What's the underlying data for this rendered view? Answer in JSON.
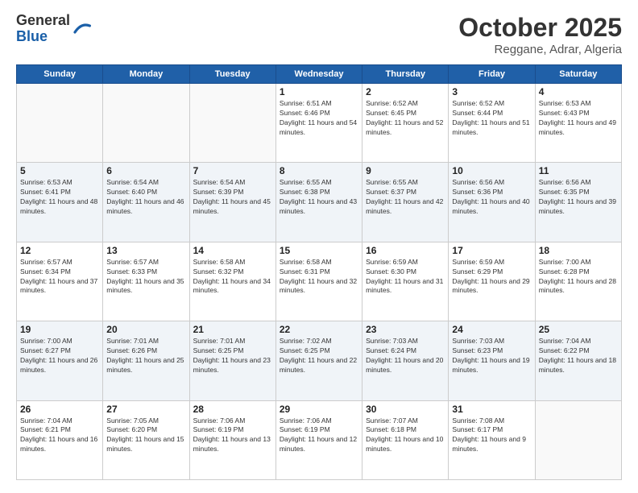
{
  "header": {
    "logo_line1": "General",
    "logo_line2": "Blue",
    "month": "October 2025",
    "location": "Reggane, Adrar, Algeria"
  },
  "weekdays": [
    "Sunday",
    "Monday",
    "Tuesday",
    "Wednesday",
    "Thursday",
    "Friday",
    "Saturday"
  ],
  "weeks": [
    [
      {
        "day": "",
        "sunrise": "",
        "sunset": "",
        "daylight": ""
      },
      {
        "day": "",
        "sunrise": "",
        "sunset": "",
        "daylight": ""
      },
      {
        "day": "",
        "sunrise": "",
        "sunset": "",
        "daylight": ""
      },
      {
        "day": "1",
        "sunrise": "Sunrise: 6:51 AM",
        "sunset": "Sunset: 6:46 PM",
        "daylight": "Daylight: 11 hours and 54 minutes."
      },
      {
        "day": "2",
        "sunrise": "Sunrise: 6:52 AM",
        "sunset": "Sunset: 6:45 PM",
        "daylight": "Daylight: 11 hours and 52 minutes."
      },
      {
        "day": "3",
        "sunrise": "Sunrise: 6:52 AM",
        "sunset": "Sunset: 6:44 PM",
        "daylight": "Daylight: 11 hours and 51 minutes."
      },
      {
        "day": "4",
        "sunrise": "Sunrise: 6:53 AM",
        "sunset": "Sunset: 6:43 PM",
        "daylight": "Daylight: 11 hours and 49 minutes."
      }
    ],
    [
      {
        "day": "5",
        "sunrise": "Sunrise: 6:53 AM",
        "sunset": "Sunset: 6:41 PM",
        "daylight": "Daylight: 11 hours and 48 minutes."
      },
      {
        "day": "6",
        "sunrise": "Sunrise: 6:54 AM",
        "sunset": "Sunset: 6:40 PM",
        "daylight": "Daylight: 11 hours and 46 minutes."
      },
      {
        "day": "7",
        "sunrise": "Sunrise: 6:54 AM",
        "sunset": "Sunset: 6:39 PM",
        "daylight": "Daylight: 11 hours and 45 minutes."
      },
      {
        "day": "8",
        "sunrise": "Sunrise: 6:55 AM",
        "sunset": "Sunset: 6:38 PM",
        "daylight": "Daylight: 11 hours and 43 minutes."
      },
      {
        "day": "9",
        "sunrise": "Sunrise: 6:55 AM",
        "sunset": "Sunset: 6:37 PM",
        "daylight": "Daylight: 11 hours and 42 minutes."
      },
      {
        "day": "10",
        "sunrise": "Sunrise: 6:56 AM",
        "sunset": "Sunset: 6:36 PM",
        "daylight": "Daylight: 11 hours and 40 minutes."
      },
      {
        "day": "11",
        "sunrise": "Sunrise: 6:56 AM",
        "sunset": "Sunset: 6:35 PM",
        "daylight": "Daylight: 11 hours and 39 minutes."
      }
    ],
    [
      {
        "day": "12",
        "sunrise": "Sunrise: 6:57 AM",
        "sunset": "Sunset: 6:34 PM",
        "daylight": "Daylight: 11 hours and 37 minutes."
      },
      {
        "day": "13",
        "sunrise": "Sunrise: 6:57 AM",
        "sunset": "Sunset: 6:33 PM",
        "daylight": "Daylight: 11 hours and 35 minutes."
      },
      {
        "day": "14",
        "sunrise": "Sunrise: 6:58 AM",
        "sunset": "Sunset: 6:32 PM",
        "daylight": "Daylight: 11 hours and 34 minutes."
      },
      {
        "day": "15",
        "sunrise": "Sunrise: 6:58 AM",
        "sunset": "Sunset: 6:31 PM",
        "daylight": "Daylight: 11 hours and 32 minutes."
      },
      {
        "day": "16",
        "sunrise": "Sunrise: 6:59 AM",
        "sunset": "Sunset: 6:30 PM",
        "daylight": "Daylight: 11 hours and 31 minutes."
      },
      {
        "day": "17",
        "sunrise": "Sunrise: 6:59 AM",
        "sunset": "Sunset: 6:29 PM",
        "daylight": "Daylight: 11 hours and 29 minutes."
      },
      {
        "day": "18",
        "sunrise": "Sunrise: 7:00 AM",
        "sunset": "Sunset: 6:28 PM",
        "daylight": "Daylight: 11 hours and 28 minutes."
      }
    ],
    [
      {
        "day": "19",
        "sunrise": "Sunrise: 7:00 AM",
        "sunset": "Sunset: 6:27 PM",
        "daylight": "Daylight: 11 hours and 26 minutes."
      },
      {
        "day": "20",
        "sunrise": "Sunrise: 7:01 AM",
        "sunset": "Sunset: 6:26 PM",
        "daylight": "Daylight: 11 hours and 25 minutes."
      },
      {
        "day": "21",
        "sunrise": "Sunrise: 7:01 AM",
        "sunset": "Sunset: 6:25 PM",
        "daylight": "Daylight: 11 hours and 23 minutes."
      },
      {
        "day": "22",
        "sunrise": "Sunrise: 7:02 AM",
        "sunset": "Sunset: 6:25 PM",
        "daylight": "Daylight: 11 hours and 22 minutes."
      },
      {
        "day": "23",
        "sunrise": "Sunrise: 7:03 AM",
        "sunset": "Sunset: 6:24 PM",
        "daylight": "Daylight: 11 hours and 20 minutes."
      },
      {
        "day": "24",
        "sunrise": "Sunrise: 7:03 AM",
        "sunset": "Sunset: 6:23 PM",
        "daylight": "Daylight: 11 hours and 19 minutes."
      },
      {
        "day": "25",
        "sunrise": "Sunrise: 7:04 AM",
        "sunset": "Sunset: 6:22 PM",
        "daylight": "Daylight: 11 hours and 18 minutes."
      }
    ],
    [
      {
        "day": "26",
        "sunrise": "Sunrise: 7:04 AM",
        "sunset": "Sunset: 6:21 PM",
        "daylight": "Daylight: 11 hours and 16 minutes."
      },
      {
        "day": "27",
        "sunrise": "Sunrise: 7:05 AM",
        "sunset": "Sunset: 6:20 PM",
        "daylight": "Daylight: 11 hours and 15 minutes."
      },
      {
        "day": "28",
        "sunrise": "Sunrise: 7:06 AM",
        "sunset": "Sunset: 6:19 PM",
        "daylight": "Daylight: 11 hours and 13 minutes."
      },
      {
        "day": "29",
        "sunrise": "Sunrise: 7:06 AM",
        "sunset": "Sunset: 6:19 PM",
        "daylight": "Daylight: 11 hours and 12 minutes."
      },
      {
        "day": "30",
        "sunrise": "Sunrise: 7:07 AM",
        "sunset": "Sunset: 6:18 PM",
        "daylight": "Daylight: 11 hours and 10 minutes."
      },
      {
        "day": "31",
        "sunrise": "Sunrise: 7:08 AM",
        "sunset": "Sunset: 6:17 PM",
        "daylight": "Daylight: 11 hours and 9 minutes."
      },
      {
        "day": "",
        "sunrise": "",
        "sunset": "",
        "daylight": ""
      }
    ]
  ]
}
